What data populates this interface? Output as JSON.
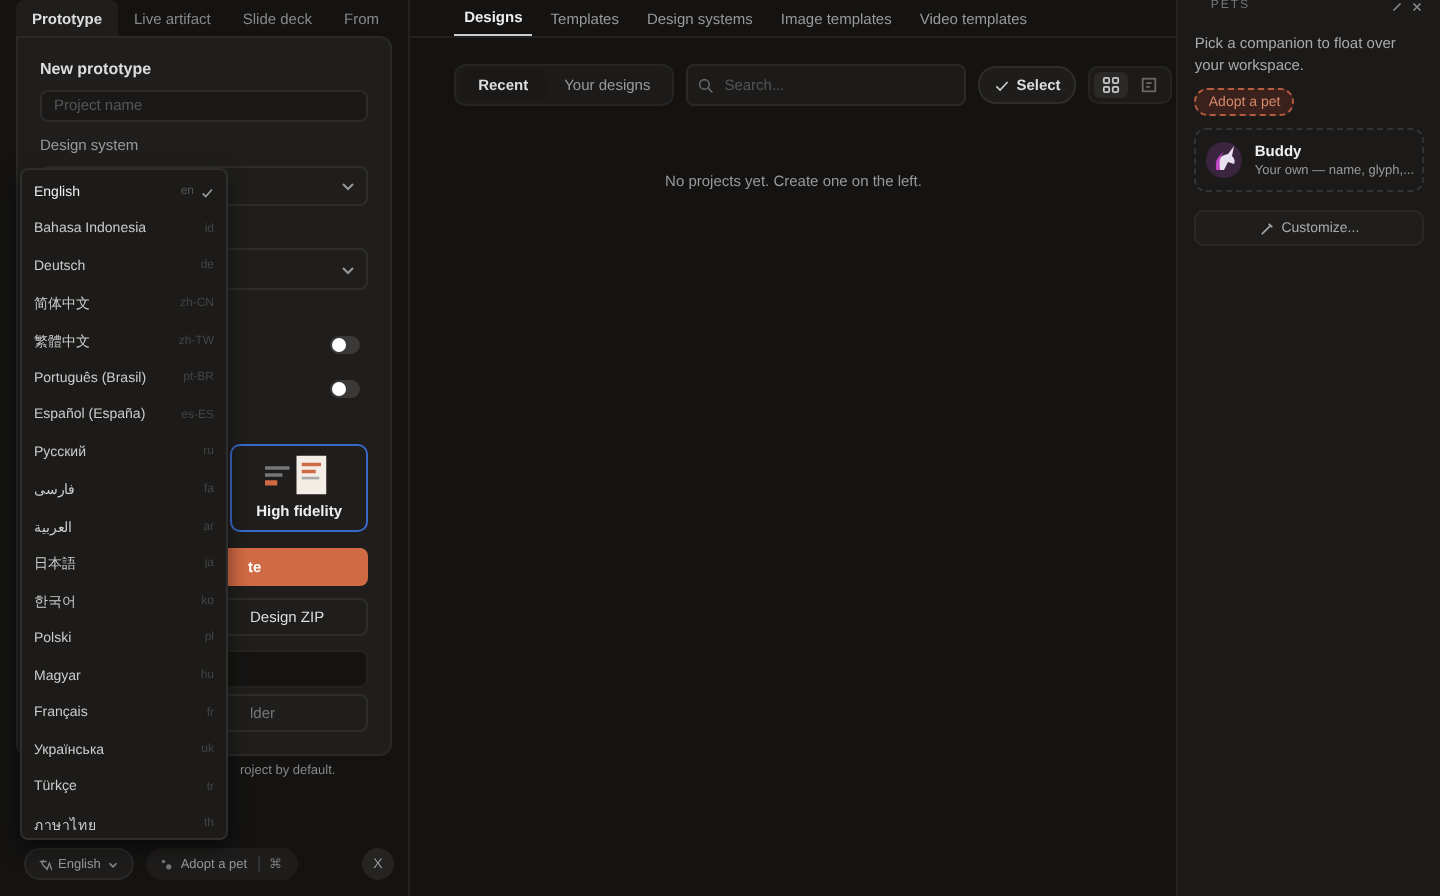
{
  "left_tabs": [
    {
      "label": "Prototype",
      "selected": true
    },
    {
      "label": "Live artifact",
      "selected": false
    },
    {
      "label": "Slide deck",
      "selected": false
    },
    {
      "label": "From",
      "selected": false
    }
  ],
  "form": {
    "title": "New prototype",
    "project_name": {
      "placeholder": "Project name"
    },
    "design_system_label": "Design system",
    "toggles": [
      {
        "on": false
      },
      {
        "on": false
      }
    ],
    "fidelity_card": {
      "label": "High fidelity",
      "selected": true
    },
    "create_button": "te",
    "import_button": "Design ZIP",
    "folder_button": "lder",
    "note": "roject by default."
  },
  "language_menu": [
    {
      "name": "English",
      "code": "en",
      "selected": true
    },
    {
      "name": "Bahasa Indonesia",
      "code": "id",
      "selected": false
    },
    {
      "name": "Deutsch",
      "code": "de",
      "selected": false
    },
    {
      "name": "简体中文",
      "code": "zh-CN",
      "selected": false
    },
    {
      "name": "繁體中文",
      "code": "zh-TW",
      "selected": false
    },
    {
      "name": "Português (Brasil)",
      "code": "pt-BR",
      "selected": false
    },
    {
      "name": "Español (España)",
      "code": "es-ES",
      "selected": false
    },
    {
      "name": "Русский",
      "code": "ru",
      "selected": false
    },
    {
      "name": "فارسی",
      "code": "fa",
      "selected": false
    },
    {
      "name": "العربية",
      "code": "ar",
      "selected": false
    },
    {
      "name": "日本語",
      "code": "ja",
      "selected": false
    },
    {
      "name": "한국어",
      "code": "ko",
      "selected": false
    },
    {
      "name": "Polski",
      "code": "pl",
      "selected": false
    },
    {
      "name": "Magyar",
      "code": "hu",
      "selected": false
    },
    {
      "name": "Français",
      "code": "fr",
      "selected": false
    },
    {
      "name": "Українська",
      "code": "uk",
      "selected": false
    },
    {
      "name": "Türkçe",
      "code": "tr",
      "selected": false
    },
    {
      "name": "ภาษาไทย",
      "code": "th",
      "selected": false
    }
  ],
  "bottom_bar": {
    "language": "English",
    "pet_button": "Adopt a pet",
    "shortcut": "⌘",
    "close": "X"
  },
  "main": {
    "tabs": [
      {
        "label": "Designs",
        "selected": true
      },
      {
        "label": "Templates",
        "selected": false
      },
      {
        "label": "Design systems",
        "selected": false
      },
      {
        "label": "Image templates",
        "selected": false
      },
      {
        "label": "Video templates",
        "selected": false
      }
    ],
    "filters": [
      {
        "label": "Recent",
        "selected": true
      },
      {
        "label": "Your designs",
        "selected": false
      }
    ],
    "search": {
      "placeholder": "Search..."
    },
    "select_button": "Select",
    "views": [
      {
        "kind": "grid",
        "selected": true
      },
      {
        "kind": "list",
        "selected": false
      }
    ],
    "empty_message": "No projects yet. Create one on the left."
  },
  "pets": {
    "title": "PETS",
    "description": "Pick a companion to float over your workspace.",
    "adopt_button": "Adopt a pet",
    "pet": {
      "name": "Buddy",
      "description": "Your own — name, glyph,..."
    },
    "customize_button": "Customize..."
  }
}
